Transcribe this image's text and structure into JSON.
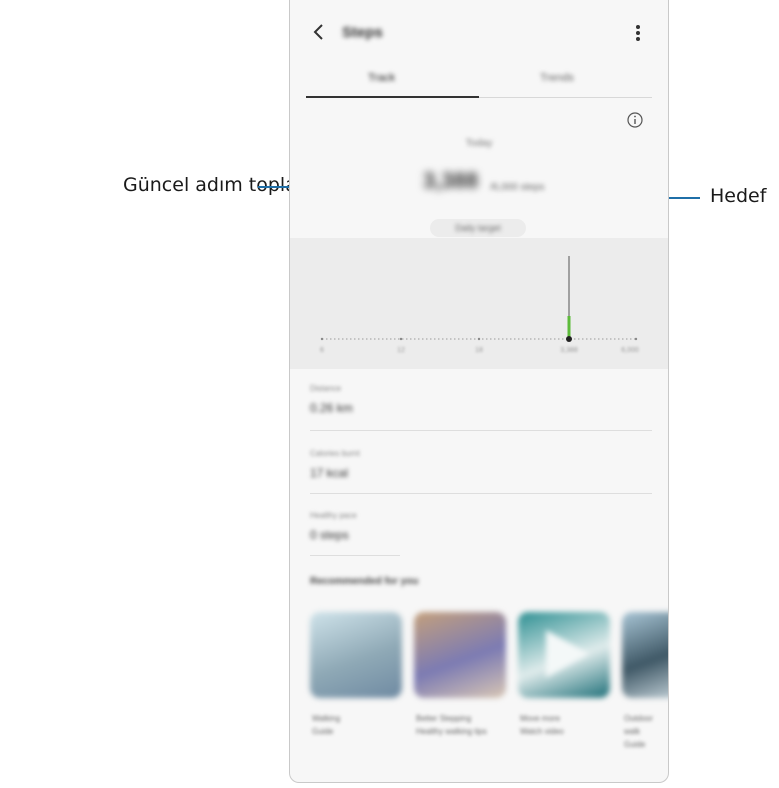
{
  "callouts": {
    "left_label": "Güncel adım toplamı",
    "right_label": "Hedef"
  },
  "app": {
    "title": "Steps",
    "tabs": [
      "Track",
      "Trends"
    ],
    "active_tab": "Track",
    "today_label": "Today",
    "step_count": "3,388",
    "step_goal": "/6,000 steps",
    "daily_target_button": "Daily target",
    "chart_ticks": [
      "6",
      "12",
      "18",
      "3,388",
      "6,000"
    ],
    "stats": [
      {
        "label": "Distance",
        "value": "0.26 km"
      },
      {
        "label": "Calories burnt",
        "value": "17 kcal"
      },
      {
        "label": "Healthy pace",
        "value": "0 steps"
      }
    ],
    "recommended_title": "Recommended for you",
    "recommended_items": [
      {
        "caption": "Walking",
        "sub": "Guide",
        "colors": [
          "#cfe3ea",
          "#8fa9b6",
          "#6f8aa2"
        ]
      },
      {
        "caption": "Better Stepping",
        "sub": "Healthy walking tips",
        "colors": [
          "#c4a07c",
          "#7c7bb3",
          "#d9c7b4"
        ]
      },
      {
        "caption": "Move more",
        "sub": "Watch video",
        "colors": [
          "#2d8f92",
          "#e0ecec",
          "#1e6f78"
        ]
      },
      {
        "caption": "Outdoor walk",
        "sub": "Guide",
        "colors": [
          "#a9c6d6",
          "#3f5866",
          "#c5d3da"
        ]
      }
    ]
  }
}
